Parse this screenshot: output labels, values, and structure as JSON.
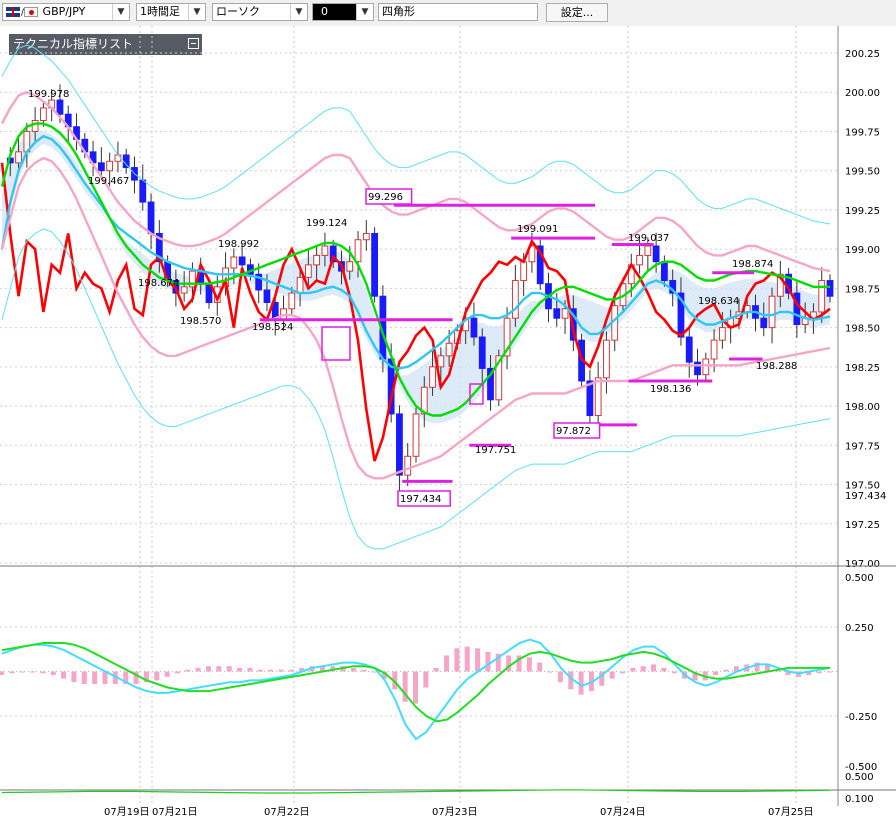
{
  "toolbar": {
    "pair": "GBP/JPY",
    "timeframe": "1時間足",
    "chart_type": "ローソク",
    "color_label": "0",
    "shape": "四角形",
    "settings_button": "設定..."
  },
  "panel": {
    "indicator_list_label": "テクニカル指標リスト"
  },
  "chart_data": [
    {
      "type": "candlestick",
      "title": "",
      "y_range": [
        197.0,
        200.25
      ],
      "y_ticks": [
        "200.25",
        "200.00",
        "199.75",
        "199.50",
        "199.25",
        "199.00",
        "198.75",
        "198.50",
        "198.25",
        "198.00",
        "197.75",
        "197.50",
        "197.25",
        "197.00"
      ],
      "y_extra_label": "197.434",
      "x_ticks": [
        "07月19日",
        "07月21日",
        "07月22日",
        "07月23日",
        "07月24日",
        "07月25日"
      ],
      "price_labels": [
        {
          "text": "199.978",
          "price": 199.978,
          "boxed": false
        },
        {
          "text": "199.467",
          "price": 199.467,
          "boxed": false
        },
        {
          "text": "198.674",
          "price": 198.674,
          "boxed": false
        },
        {
          "text": "198.570",
          "price": 198.57,
          "boxed": false
        },
        {
          "text": "198.992",
          "price": 198.992,
          "boxed": false
        },
        {
          "text": "198.524",
          "price": 198.524,
          "boxed": false
        },
        {
          "text": "199.124",
          "price": 199.124,
          "boxed": false
        },
        {
          "text": "99.296",
          "price": 199.296,
          "boxed": true
        },
        {
          "text": "197.434",
          "price": 197.434,
          "boxed": true
        },
        {
          "text": "197.751",
          "price": 197.751,
          "boxed": false
        },
        {
          "text": "199.091",
          "price": 199.091,
          "boxed": false
        },
        {
          "text": "97.872",
          "price": 197.872,
          "boxed": true
        },
        {
          "text": "199.037",
          "price": 199.037,
          "boxed": false
        },
        {
          "text": "198.136",
          "price": 198.136,
          "boxed": false
        },
        {
          "text": "198.634",
          "price": 198.634,
          "boxed": false
        },
        {
          "text": "198.874",
          "price": 198.874,
          "boxed": false
        },
        {
          "text": "198.288",
          "price": 198.288,
          "boxed": false
        }
      ],
      "hlines": [
        {
          "price": 199.28,
          "from": 0.47,
          "to": 0.71
        },
        {
          "price": 199.07,
          "from": 0.61,
          "to": 0.71
        },
        {
          "price": 199.03,
          "from": 0.73,
          "to": 0.78
        },
        {
          "price": 198.55,
          "from": 0.31,
          "to": 0.54
        },
        {
          "price": 197.75,
          "from": 0.56,
          "to": 0.61
        },
        {
          "price": 197.88,
          "from": 0.67,
          "to": 0.76
        },
        {
          "price": 198.16,
          "from": 0.75,
          "to": 0.85
        },
        {
          "price": 198.3,
          "from": 0.87,
          "to": 0.91
        },
        {
          "price": 198.85,
          "from": 0.85,
          "to": 0.9
        },
        {
          "price": 197.52,
          "from": 0.48,
          "to": 0.54
        }
      ],
      "close_series": [
        199.58,
        199.55,
        199.62,
        199.75,
        199.82,
        199.9,
        199.95,
        199.86,
        199.78,
        199.7,
        199.62,
        199.55,
        199.5,
        199.56,
        199.6,
        199.52,
        199.44,
        199.3,
        199.1,
        198.92,
        198.8,
        198.72,
        198.76,
        198.86,
        198.78,
        198.66,
        198.76,
        198.88,
        198.95,
        198.9,
        198.84,
        198.74,
        198.66,
        198.55,
        198.62,
        198.72,
        198.82,
        198.9,
        198.96,
        199.02,
        198.92,
        198.86,
        198.92,
        199.06,
        199.1,
        198.7,
        198.3,
        197.95,
        197.56,
        197.68,
        197.95,
        198.12,
        198.25,
        198.32,
        198.4,
        198.48,
        198.56,
        198.44,
        198.24,
        198.04,
        198.32,
        198.56,
        198.8,
        198.92,
        199.02,
        198.78,
        198.62,
        198.56,
        198.62,
        198.42,
        198.16,
        197.94,
        198.18,
        198.42,
        198.64,
        198.78,
        198.9,
        198.96,
        199.02,
        198.92,
        198.8,
        198.72,
        198.44,
        198.28,
        198.2,
        198.3,
        198.42,
        198.5,
        198.56,
        198.6,
        198.64,
        198.56,
        198.5,
        198.7,
        198.84,
        198.72,
        198.52,
        198.56,
        198.6,
        198.8,
        198.7
      ],
      "series": [
        {
          "name": "",
          "color": "#ff0000",
          "values": [
            199.55,
            199.1,
            198.7,
            199.05,
            199.0,
            198.6,
            198.9,
            198.85,
            199.1,
            198.75,
            198.85,
            198.78,
            198.75,
            198.6,
            198.8,
            198.9,
            198.62,
            198.58,
            198.9,
            198.95,
            198.8,
            198.75,
            198.62,
            198.68,
            198.9,
            198.8,
            198.68,
            198.8,
            198.5,
            198.88,
            198.72,
            198.6,
            198.55,
            198.7,
            198.9,
            199.0,
            198.88,
            198.75,
            198.8,
            198.78,
            198.95,
            198.9,
            198.7,
            198.42,
            197.98,
            197.65,
            197.8,
            198.05,
            198.28,
            198.35,
            198.45,
            198.5,
            198.42,
            198.12,
            198.2,
            198.4,
            198.6,
            198.7,
            198.8,
            198.85,
            198.92,
            198.9,
            198.95,
            198.92,
            199.05,
            198.98,
            198.88,
            198.86,
            198.8,
            198.48,
            198.3,
            198.25,
            198.38,
            198.55,
            198.7,
            198.8,
            198.9,
            198.82,
            198.72,
            198.6,
            198.55,
            198.48,
            198.45,
            198.5,
            198.58,
            198.62,
            198.65,
            198.55,
            198.5,
            198.52,
            198.7,
            198.78,
            198.8,
            198.85,
            198.82,
            198.75,
            198.65,
            198.6,
            198.55,
            198.58,
            198.62
          ]
        },
        {
          "name": "",
          "color": "#2ec7f2",
          "values": [
            199.0,
            199.3,
            199.5,
            199.62,
            199.68,
            199.72,
            199.7,
            199.65,
            199.58,
            199.5,
            199.42,
            199.35,
            199.28,
            199.2,
            199.14,
            199.1,
            199.06,
            199.02,
            198.98,
            198.95,
            198.92,
            198.9,
            198.88,
            198.87,
            198.86,
            198.85,
            198.84,
            198.84,
            198.84,
            198.84,
            198.83,
            198.82,
            198.8,
            198.78,
            198.76,
            198.74,
            198.72,
            198.72,
            198.73,
            198.75,
            198.76,
            198.74,
            198.7,
            198.6,
            198.48,
            198.38,
            198.3,
            198.25,
            198.24,
            198.25,
            198.28,
            198.32,
            198.36,
            198.4,
            198.45,
            198.5,
            198.55,
            198.58,
            198.58,
            198.56,
            198.56,
            198.58,
            198.62,
            198.68,
            198.72,
            198.72,
            198.7,
            198.68,
            198.64,
            198.58,
            198.5,
            198.46,
            198.46,
            198.5,
            198.55,
            198.6,
            198.66,
            198.72,
            198.78,
            198.8,
            198.78,
            198.74,
            198.68,
            198.6,
            198.55,
            198.52,
            198.52,
            198.54,
            198.56,
            198.58,
            198.6,
            198.6,
            198.58,
            198.58,
            198.6,
            198.6,
            198.58,
            198.56,
            198.55,
            198.56,
            198.57
          ]
        },
        {
          "name": "",
          "color": "#00dd00",
          "values": [
            199.4,
            199.6,
            199.72,
            199.78,
            199.8,
            199.8,
            199.78,
            199.74,
            199.68,
            199.6,
            199.5,
            199.4,
            199.3,
            199.2,
            199.1,
            199.02,
            198.96,
            198.9,
            198.86,
            198.82,
            198.8,
            198.78,
            198.78,
            198.78,
            198.78,
            198.78,
            198.79,
            198.8,
            198.82,
            198.84,
            198.86,
            198.88,
            198.9,
            198.92,
            198.94,
            198.96,
            198.98,
            199.0,
            199.02,
            199.04,
            199.04,
            199.02,
            198.98,
            198.9,
            198.78,
            198.62,
            198.46,
            198.32,
            198.18,
            198.08,
            198.0,
            197.96,
            197.94,
            197.94,
            197.96,
            197.98,
            198.02,
            198.08,
            198.14,
            198.2,
            198.28,
            198.36,
            198.44,
            198.52,
            198.6,
            198.66,
            198.7,
            198.74,
            198.76,
            198.76,
            198.74,
            198.72,
            198.7,
            198.68,
            198.68,
            198.7,
            198.74,
            198.8,
            198.86,
            198.9,
            198.92,
            198.92,
            198.9,
            198.86,
            198.82,
            198.8,
            198.8,
            198.82,
            198.84,
            198.85,
            198.86,
            198.86,
            198.85,
            198.84,
            198.83,
            198.82,
            198.8,
            198.78,
            198.76,
            198.76,
            198.76
          ]
        },
        {
          "name": "",
          "color": "#f5a6c8",
          "values": [
            199.8,
            199.9,
            199.98,
            200.0,
            199.98,
            199.94,
            199.9,
            199.84,
            199.78,
            199.7,
            199.62,
            199.54,
            199.46,
            199.38,
            199.3,
            199.24,
            199.18,
            199.14,
            199.1,
            199.07,
            199.05,
            199.03,
            199.02,
            199.02,
            199.03,
            199.05,
            199.07,
            199.1,
            199.14,
            199.18,
            199.22,
            199.26,
            199.3,
            199.34,
            199.38,
            199.42,
            199.46,
            199.5,
            199.54,
            199.58,
            199.6,
            199.6,
            199.58,
            199.5,
            199.42,
            199.34,
            199.28,
            199.24,
            199.22,
            199.22,
            199.24,
            199.26,
            199.28,
            199.3,
            199.32,
            199.32,
            199.3,
            199.26,
            199.22,
            199.18,
            199.14,
            199.12,
            199.12,
            199.14,
            199.16,
            199.2,
            199.24,
            199.26,
            199.26,
            199.24,
            199.2,
            199.16,
            199.12,
            199.08,
            199.06,
            199.06,
            199.08,
            199.12,
            199.16,
            199.2,
            199.2,
            199.18,
            199.14,
            199.08,
            199.02,
            198.98,
            198.96,
            198.96,
            198.98,
            199.0,
            199.02,
            199.02,
            199.0,
            198.98,
            198.96,
            198.94,
            198.92,
            198.9,
            198.88,
            198.87,
            198.86
          ]
        },
        {
          "name": "",
          "color": "#f5a6c8",
          "values": [
            199.0,
            199.2,
            199.4,
            199.5,
            199.55,
            199.58,
            199.56,
            199.5,
            199.42,
            199.32,
            199.2,
            199.08,
            198.96,
            198.84,
            198.72,
            198.62,
            198.52,
            198.44,
            198.38,
            198.34,
            198.32,
            198.32,
            198.34,
            198.36,
            198.38,
            198.4,
            198.42,
            198.44,
            198.46,
            198.48,
            198.5,
            198.52,
            198.54,
            198.56,
            198.58,
            198.58,
            198.56,
            198.5,
            198.42,
            198.3,
            198.12,
            197.92,
            197.74,
            197.62,
            197.56,
            197.54,
            197.54,
            197.56,
            197.58,
            197.6,
            197.62,
            197.64,
            197.66,
            197.68,
            197.72,
            197.76,
            197.8,
            197.84,
            197.88,
            197.92,
            197.96,
            198.0,
            198.04,
            198.06,
            198.08,
            198.08,
            198.08,
            198.08,
            198.08,
            198.1,
            198.12,
            198.14,
            198.16,
            198.16,
            198.16,
            198.16,
            198.16,
            198.18,
            198.2,
            198.22,
            198.24,
            198.26,
            198.26,
            198.26,
            198.26,
            198.26,
            198.26,
            198.26,
            198.26,
            198.26,
            198.27,
            198.28,
            198.29,
            198.3,
            198.31,
            198.32,
            198.33,
            198.34,
            198.35,
            198.36,
            198.37
          ]
        }
      ]
    },
    {
      "type": "line",
      "title": "",
      "y_range": [
        -0.5,
        0.5
      ],
      "y_ticks": [
        "0.500",
        "0.250",
        "-0.250",
        "-0.500"
      ],
      "series": [
        {
          "name": "",
          "color": "#44ddff",
          "values": [
            0.1,
            0.12,
            0.14,
            0.15,
            0.15,
            0.14,
            0.12,
            0.09,
            0.06,
            0.03,
            0.0,
            -0.03,
            -0.06,
            -0.09,
            -0.11,
            -0.12,
            -0.12,
            -0.11,
            -0.1,
            -0.09,
            -0.08,
            -0.07,
            -0.06,
            -0.06,
            -0.05,
            -0.05,
            -0.04,
            -0.03,
            -0.02,
            0.0,
            0.02,
            0.03,
            0.04,
            0.05,
            0.05,
            0.04,
            0.02,
            -0.05,
            -0.16,
            -0.3,
            -0.38,
            -0.34,
            -0.26,
            -0.18,
            -0.1,
            -0.04,
            0.0,
            0.04,
            0.08,
            0.12,
            0.16,
            0.18,
            0.16,
            0.1,
            0.02,
            -0.04,
            -0.08,
            -0.06,
            -0.02,
            0.03,
            0.08,
            0.12,
            0.14,
            0.14,
            0.1,
            0.04,
            -0.02,
            -0.06,
            -0.08,
            -0.06,
            -0.03,
            0.0,
            0.02,
            0.04,
            0.04,
            0.02,
            0.0,
            -0.01,
            0.0,
            0.01,
            0.02
          ]
        },
        {
          "name": "",
          "color": "#22dd22",
          "values": [
            0.12,
            0.13,
            0.14,
            0.15,
            0.16,
            0.16,
            0.16,
            0.15,
            0.13,
            0.1,
            0.07,
            0.04,
            0.01,
            -0.02,
            -0.05,
            -0.07,
            -0.09,
            -0.1,
            -0.11,
            -0.11,
            -0.11,
            -0.1,
            -0.09,
            -0.08,
            -0.07,
            -0.06,
            -0.05,
            -0.04,
            -0.03,
            -0.02,
            -0.01,
            0.0,
            0.01,
            0.02,
            0.03,
            0.03,
            0.02,
            -0.01,
            -0.06,
            -0.13,
            -0.2,
            -0.25,
            -0.28,
            -0.27,
            -0.23,
            -0.18,
            -0.13,
            -0.07,
            -0.02,
            0.03,
            0.07,
            0.1,
            0.11,
            0.1,
            0.08,
            0.06,
            0.05,
            0.05,
            0.06,
            0.07,
            0.09,
            0.1,
            0.11,
            0.1,
            0.08,
            0.05,
            0.02,
            -0.01,
            -0.03,
            -0.04,
            -0.04,
            -0.03,
            -0.02,
            -0.01,
            0.0,
            0.01,
            0.02,
            0.02,
            0.02,
            0.02,
            0.02
          ]
        }
      ]
    },
    {
      "type": "line",
      "title": "",
      "y_range": [
        0.1,
        0.5
      ],
      "y_ticks": [
        "0.500",
        "0.100"
      ],
      "series": [
        {
          "name": "",
          "color": "#22cc22",
          "values": [
            0.2,
            0.21,
            0.22,
            0.22,
            0.21,
            0.2,
            0.19,
            0.19,
            0.2,
            0.21,
            0.22,
            0.23,
            0.24,
            0.25,
            0.24,
            0.23,
            0.22,
            0.22,
            0.23,
            0.24
          ]
        }
      ]
    }
  ]
}
